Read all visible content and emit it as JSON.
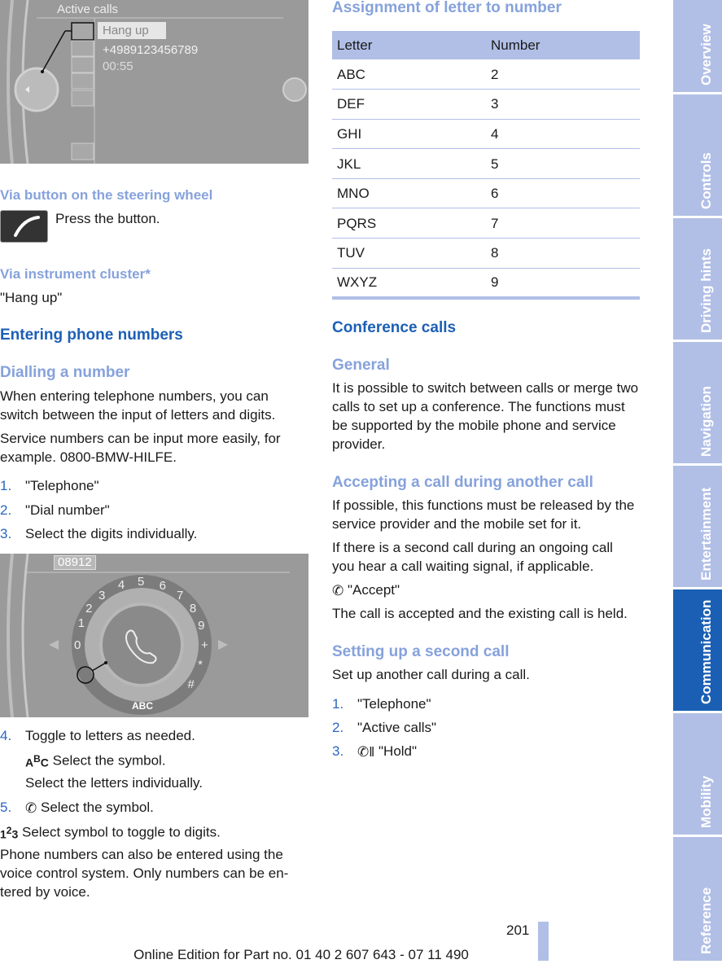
{
  "screen1": {
    "title": "Active calls",
    "menu": "Hang up",
    "number": "+4989123456789",
    "time": "00:55"
  },
  "screen2": {
    "entry": "08912",
    "digits": [
      "1",
      "2",
      "3",
      "4",
      "5",
      "6",
      "7",
      "8",
      "9",
      "0",
      "+",
      "*",
      "#"
    ],
    "abc": "ABC"
  },
  "left": {
    "h_steering": "Via button on the steering wheel",
    "press": "Press the button.",
    "h_cluster": "Via instrument cluster*",
    "hangup": "\"Hang up\"",
    "h_entering": "Entering phone numbers",
    "h_dialling": "Dialling a number",
    "p1": "When entering telephone numbers, you can switch between the input of letters and digits.",
    "p2": "Service numbers can be input more easily, for example. 0800-BMW-HILFE.",
    "steps": [
      {
        "n": "1.",
        "t": "\"Telephone\""
      },
      {
        "n": "2.",
        "t": "\"Dial number\""
      },
      {
        "n": "3.",
        "t": "Select the digits individually."
      },
      {
        "n": "4.",
        "t": "Toggle to letters as needed."
      },
      {
        "n": "5.",
        "t": "Select the symbol."
      }
    ],
    "abc_text": "Select the symbol.",
    "letters_text": "Select the letters individually.",
    "digits_text": "Select symbol to toggle to digits.",
    "p3": "Phone numbers can also be entered using the voice control system. Only numbers can be en­tered by voice."
  },
  "right": {
    "h_assign": "Assignment of letter to number",
    "table": {
      "headers": [
        "Letter",
        "Number"
      ],
      "rows": [
        [
          "ABC",
          "2"
        ],
        [
          "DEF",
          "3"
        ],
        [
          "GHI",
          "4"
        ],
        [
          "JKL",
          "5"
        ],
        [
          "MNO",
          "6"
        ],
        [
          "PQRS",
          "7"
        ],
        [
          "TUV",
          "8"
        ],
        [
          "WXYZ",
          "9"
        ]
      ]
    },
    "h_conf": "Conference calls",
    "h_general": "General",
    "p_general": "It is possible to switch between calls or merge two calls to set up a conference. The functions must be supported by the mobile phone and service provider.",
    "h_accept": "Accepting a call during another call",
    "p_acc1": "If possible, this functions must be released by the service provider and the mobile set for it.",
    "p_acc2": "If there is a second call during an ongoing call you hear a call waiting signal, if applicable.",
    "accept": "\"Accept\"",
    "p_acc3": "The call is accepted and the existing call is held.",
    "h_second": "Setting up a second call",
    "p_second": "Set up another call during a call.",
    "steps": [
      {
        "n": "1.",
        "t": "\"Telephone\""
      },
      {
        "n": "2.",
        "t": "\"Active calls\""
      },
      {
        "n": "3.",
        "t": "\"Hold\""
      }
    ]
  },
  "tabs": [
    "Overview",
    "Controls",
    "Driving hints",
    "Navigation",
    "Entertainment",
    "Communication",
    "Mobility",
    "Reference"
  ],
  "active_tab": "Communication",
  "footer": {
    "page": "201",
    "edition": "Online Edition for Part no. 01 40 2 607 643 - 07 11 490"
  },
  "colors": {
    "heading": "#1c5fb5",
    "subheading": "#86a2dc",
    "tab": "#b1bfe6",
    "tab_active": "#1a5fb4"
  }
}
